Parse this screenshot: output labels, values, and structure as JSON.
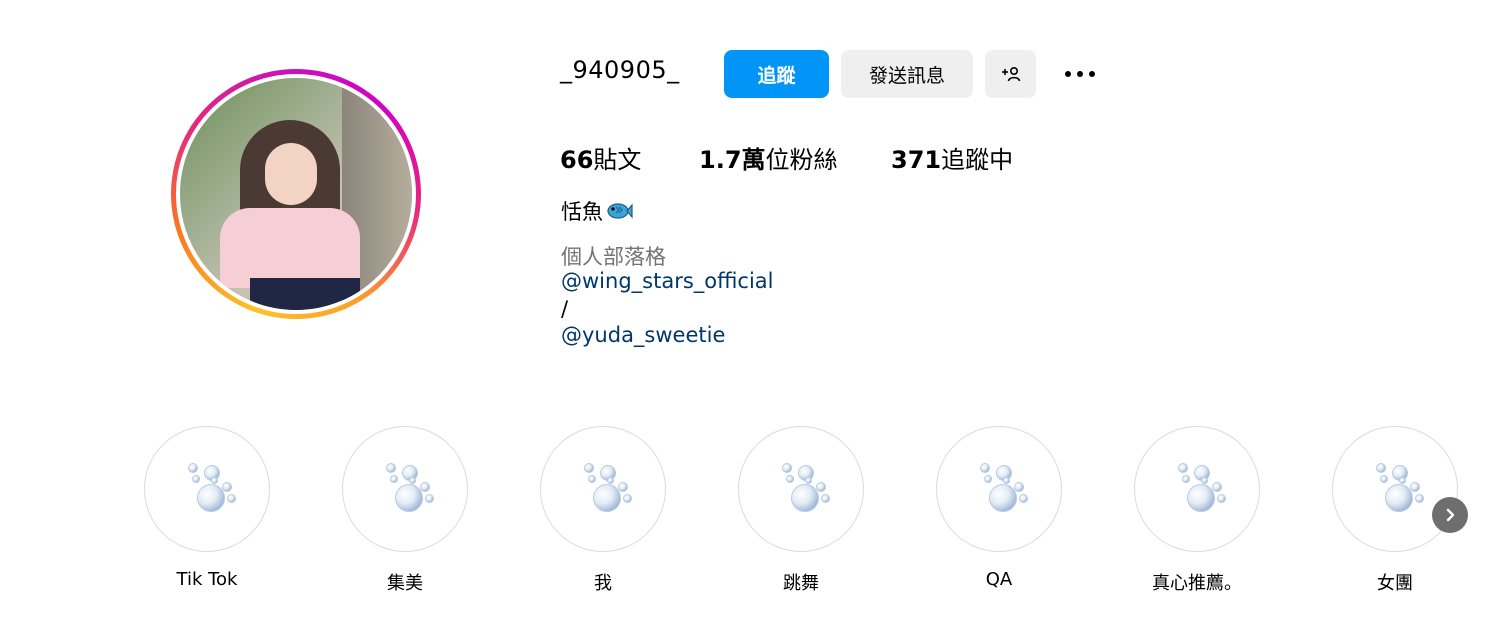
{
  "profile": {
    "username": "_940905_",
    "follow_label": "追蹤",
    "message_label": "發送訊息",
    "add_user_icon": "add-user-icon",
    "more_icon": "more-options-icon"
  },
  "stats": {
    "posts_count": "66",
    "posts_label": "貼文",
    "followers_count": "1.7萬",
    "followers_label": "位粉絲",
    "following_count": "371",
    "following_label": "追蹤中"
  },
  "bio": {
    "name": "恬魚",
    "name_emoji": "fish-icon",
    "category": "個人部落格",
    "mention1": "@wing_stars_official",
    "separator": "/",
    "mention2": "@yuda_sweetie"
  },
  "highlights": [
    {
      "label": "Tik Tok"
    },
    {
      "label": "集美"
    },
    {
      "label": "我"
    },
    {
      "label": "跳舞"
    },
    {
      "label": "QA"
    },
    {
      "label": "真心推薦。"
    },
    {
      "label": "女團"
    }
  ],
  "colors": {
    "follow_button": "#0095f6",
    "secondary_button": "#efefef",
    "link": "#00376b",
    "muted": "#737373"
  }
}
